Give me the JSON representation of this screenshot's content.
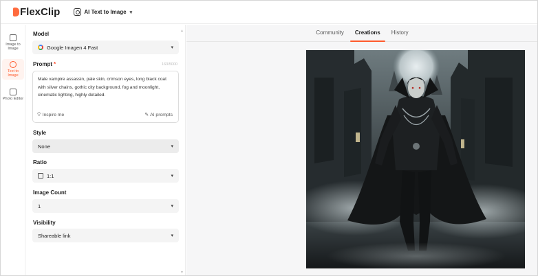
{
  "header": {
    "logo_text": "FlexClip",
    "tool_name": "AI Text to Image"
  },
  "rail": {
    "items": [
      {
        "label": "Image to Image",
        "icon": "image-to-image-icon"
      },
      {
        "label": "Text to Image",
        "icon": "text-to-image-icon",
        "active": true
      },
      {
        "label": "Photo Editor",
        "icon": "photo-editor-icon"
      }
    ]
  },
  "panel": {
    "model": {
      "label": "Model",
      "value": "Google Imagen 4 Fast"
    },
    "prompt": {
      "label": "Prompt",
      "required_mark": "*",
      "count": "163/5000",
      "text": "Male vampire assassin, pale skin, crimson eyes, long black coat with silver chains, gothic city background, fog and moonlight, cinematic lighting, highly detailed.",
      "inspire_label": "Inspire me",
      "ai_prompts_label": "AI prompts"
    },
    "style": {
      "label": "Style",
      "value": "None"
    },
    "ratio": {
      "label": "Ratio",
      "value": "1:1"
    },
    "image_count": {
      "label": "Image Count",
      "value": "1"
    },
    "visibility": {
      "label": "Visibility",
      "value": "Shareable link"
    }
  },
  "main": {
    "tabs": [
      {
        "label": "Community"
      },
      {
        "label": "Creations",
        "active": true
      },
      {
        "label": "History"
      }
    ]
  },
  "colors": {
    "accent": "#ff5a2c",
    "brand": "#ff6a3d"
  }
}
